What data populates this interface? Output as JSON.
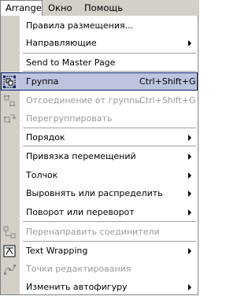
{
  "menubar": {
    "arrange": "Arrange",
    "window": "Окно",
    "help": "Помощь"
  },
  "menu": {
    "layout_rules": "Правила размещения...",
    "guides": "Направляющие",
    "send_to_master": "Send to Master Page",
    "group": "Группа",
    "group_shortcut": "Ctrl+Shift+G",
    "ungroup": "Отсоединение от группы",
    "ungroup_shortcut": "Ctrl+Shift+G",
    "regroup": "Перегруппировать",
    "order": "Порядок",
    "snap": "Привязка перемещений",
    "nudge": "Толчок",
    "align": "Выровнять или распределить",
    "rotate": "Поворот или переворот",
    "reroute": "Перенаправить соединители",
    "text_wrapping": "Text Wrapping",
    "edit_points": "Точки редактирования",
    "change_autoshape": "Изменить автофигуру"
  }
}
